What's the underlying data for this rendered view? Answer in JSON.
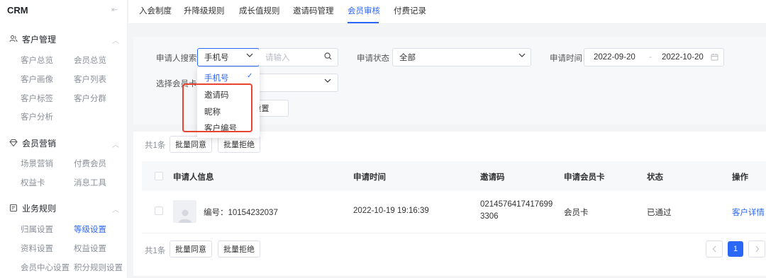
{
  "sidebar": {
    "brand": "CRM",
    "collapse_icon": "collapse-icon",
    "groups": [
      {
        "title": "客户管理",
        "icon": "users-icon",
        "items": [
          "客户总览",
          "会员总览",
          "客户画像",
          "客户列表",
          "客户标签",
          "客户分群",
          "客户分析"
        ]
      },
      {
        "title": "会员营销",
        "icon": "diamond-icon",
        "items": [
          "场景营销",
          "付费会员",
          "权益卡",
          "消息工具"
        ]
      },
      {
        "title": "业务规则",
        "icon": "document-icon",
        "items": [
          "归属设置",
          "等级设置",
          "资料设置",
          "权益设置",
          "会员中心设置",
          "积分规则设置"
        ]
      }
    ],
    "active_item": "等级设置"
  },
  "tabs": [
    "入会制度",
    "升降级规则",
    "成长值规则",
    "邀请码管理",
    "会员审核",
    "付费记录"
  ],
  "active_tab": "会员审核",
  "filters": {
    "applicant_label": "申请人搜索",
    "applicant_type": "手机号",
    "applicant_placeholder": "请输入",
    "status_label": "申请状态",
    "status_value": "全部",
    "time_label": "申请时间",
    "date_start": "2022-09-20",
    "date_sep": "-",
    "date_end": "2022-10-20",
    "card_label": "选择会员卡",
    "reset_label": "重置"
  },
  "dropdown": {
    "options": [
      "手机号",
      "邀请码",
      "昵称",
      "客户编号"
    ],
    "selected": "手机号"
  },
  "batch": {
    "count": "共1条",
    "approve": "批量同意",
    "reject": "批量拒绝"
  },
  "table": {
    "headers": [
      "申请人信息",
      "申请时间",
      "邀请码",
      "申请会员卡",
      "状态",
      "操作"
    ],
    "rows": [
      {
        "applicant": "编号：10154232037",
        "time": "2022-10-19 19:16:39",
        "code_line1": "0214576417417699",
        "code_line2": "3306",
        "card": "会员卡",
        "status": "已通过",
        "action": "客户详情"
      }
    ]
  },
  "footer": {
    "count": "共1条",
    "approve": "批量同意",
    "reject": "批量拒绝",
    "page": "1"
  },
  "colors": {
    "accent": "#2b67f6",
    "highlight": "#e8442f"
  }
}
